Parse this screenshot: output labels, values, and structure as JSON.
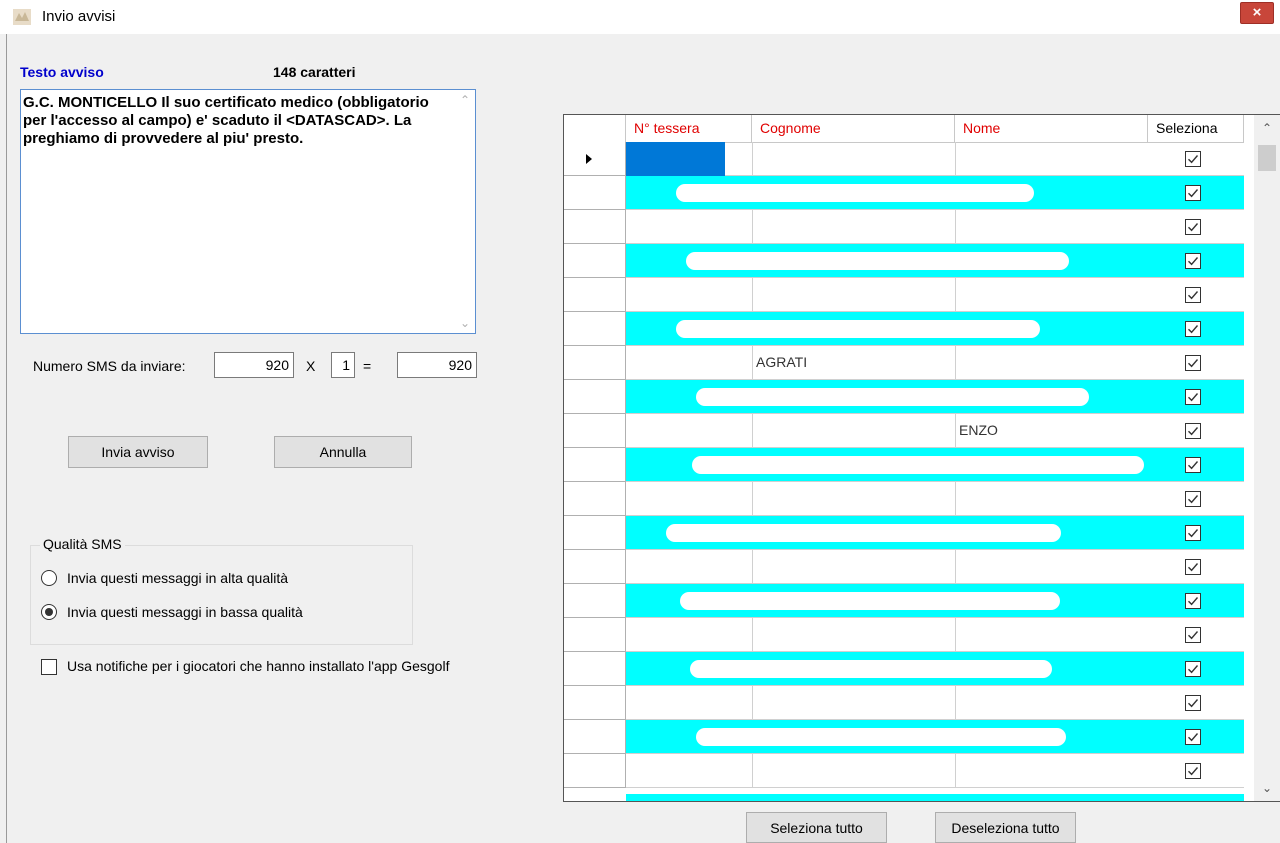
{
  "window": {
    "title": "Invio avvisi",
    "close_glyph": "×"
  },
  "message": {
    "label": "Testo avviso",
    "char_count": "148 caratteri",
    "text": "G.C. MONTICELLO Il suo certificato medico (obbligatorio per l'accesso al campo) e' scaduto il <DATASCAD>. La preghiamo di provvedere al piu' presto."
  },
  "sms_count": {
    "label": "Numero SMS da inviare:",
    "recipients": "920",
    "times_symbol": "X",
    "multiplier": "1",
    "equals_symbol": "=",
    "total": "920"
  },
  "buttons": {
    "send": "Invia avviso",
    "cancel": "Annulla",
    "select_all": "Seleziona tutto",
    "deselect_all": "Deseleziona tutto"
  },
  "quality": {
    "legend": "Qualità SMS",
    "options": [
      {
        "label": "Invia questi messaggi in alta qualità",
        "selected": false
      },
      {
        "label": "Invia questi messaggi in bassa qualità",
        "selected": true
      }
    ]
  },
  "notifications": {
    "label": "Usa notifiche  per i giocatori che hanno installato l'app Gesgolf",
    "checked": false
  },
  "grid": {
    "columns": [
      "N° tessera",
      "Cognome",
      "Nome",
      "Seleziona"
    ],
    "rows": [
      {
        "tessera": "",
        "cognome": "",
        "nome": "",
        "checked": true
      },
      {
        "tessera": "",
        "cognome": "",
        "nome": "",
        "checked": true
      },
      {
        "tessera": "",
        "cognome": "",
        "nome": "",
        "checked": true
      },
      {
        "tessera": "",
        "cognome": "",
        "nome": "",
        "checked": true
      },
      {
        "tessera": "",
        "cognome": "",
        "nome": "",
        "checked": true
      },
      {
        "tessera": "",
        "cognome": "",
        "nome": "",
        "checked": true
      },
      {
        "tessera": "",
        "cognome": "AGRATI",
        "nome": "",
        "checked": true
      },
      {
        "tessera": "",
        "cognome": "",
        "nome": "",
        "checked": true
      },
      {
        "tessera": "",
        "cognome": "",
        "nome": "ENZO",
        "checked": true
      },
      {
        "tessera": "",
        "cognome": "",
        "nome": "",
        "checked": true
      },
      {
        "tessera": "",
        "cognome": "",
        "nome": "",
        "checked": true
      },
      {
        "tessera": "",
        "cognome": "",
        "nome": "",
        "checked": true
      },
      {
        "tessera": "",
        "cognome": "",
        "nome": "",
        "checked": true
      },
      {
        "tessera": "",
        "cognome": "",
        "nome": "",
        "checked": true
      },
      {
        "tessera": "",
        "cognome": "",
        "nome": "",
        "checked": true
      },
      {
        "tessera": "",
        "cognome": "",
        "nome": "",
        "checked": true
      },
      {
        "tessera": "",
        "cognome": "",
        "nome": "",
        "checked": true
      },
      {
        "tessera": "",
        "cognome": "",
        "nome": "",
        "checked": true
      },
      {
        "tessera": "",
        "cognome": "",
        "nome": "",
        "checked": true
      }
    ]
  },
  "colors": {
    "row_alt": "#00ffff",
    "header_text": "#e00000",
    "selection": "#0078d7",
    "label_blue": "#0000cc"
  }
}
